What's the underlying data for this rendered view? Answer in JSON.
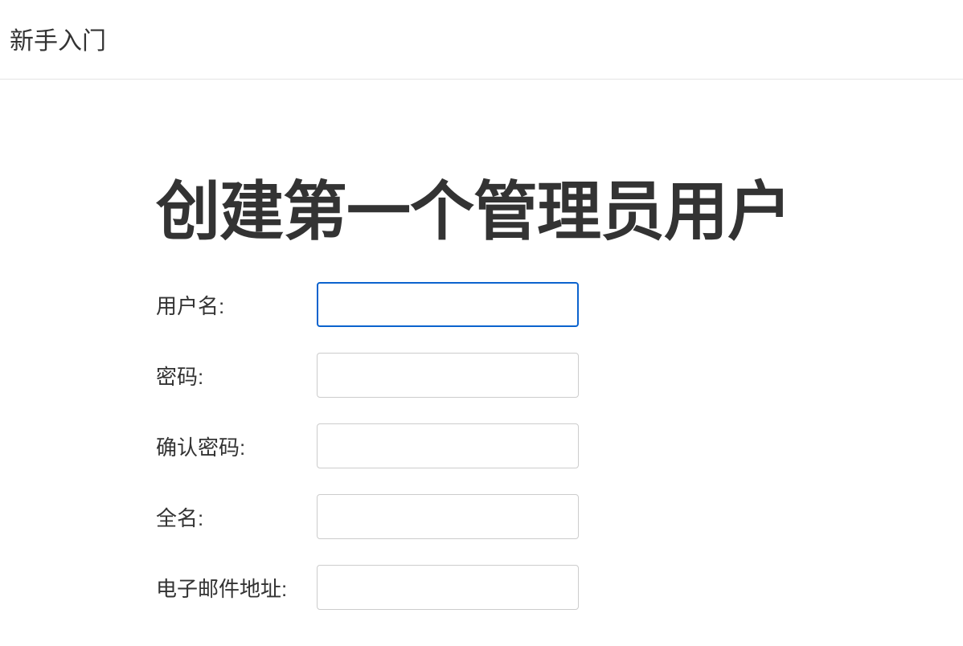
{
  "header": {
    "title": "新手入门"
  },
  "main": {
    "heading": "创建第一个管理员用户"
  },
  "form": {
    "fields": [
      {
        "label": "用户名:",
        "value": "",
        "focused": true
      },
      {
        "label": "密码:",
        "value": "",
        "focused": false
      },
      {
        "label": "确认密码:",
        "value": "",
        "focused": false
      },
      {
        "label": "全名:",
        "value": "",
        "focused": false
      },
      {
        "label": "电子邮件地址:",
        "value": "",
        "focused": false
      }
    ]
  }
}
